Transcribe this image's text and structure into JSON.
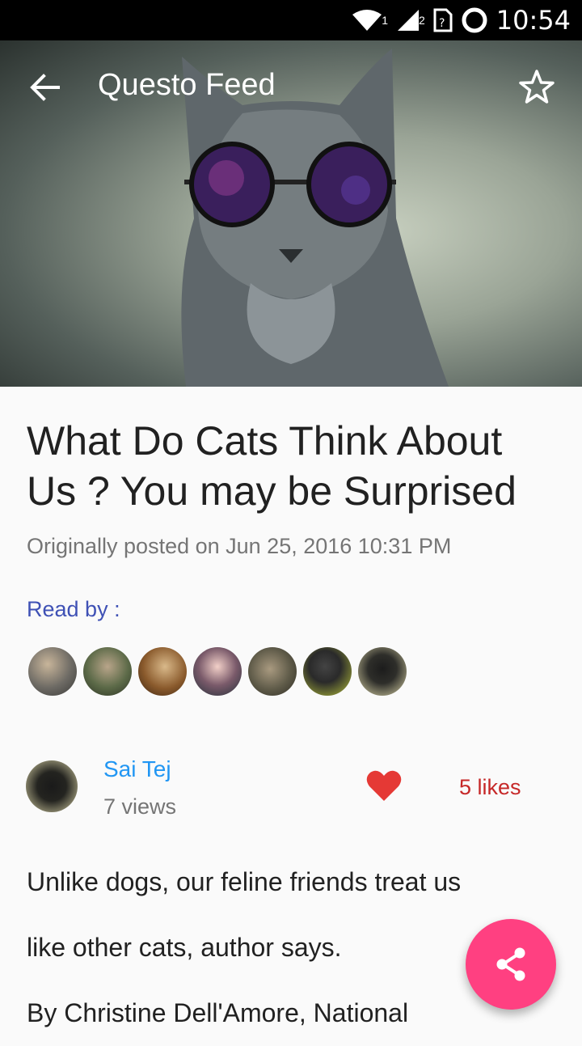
{
  "status_bar": {
    "time": "10:54",
    "sim1": "1",
    "sim2": "2"
  },
  "toolbar": {
    "title": "Questo Feed",
    "back_icon": "arrow-left-icon",
    "star_icon": "star-outline-icon"
  },
  "article": {
    "title": "What Do Cats Think About Us ? You may be Surprised",
    "posted": "Originally posted on Jun 25, 2016 10:31 PM"
  },
  "read_by": {
    "label": "Read by :",
    "count": 7
  },
  "author": {
    "name": "Sai Tej",
    "views": "7 views",
    "likes": "5 likes"
  },
  "body": {
    "lines": [
      "Unlike dogs, our feline friends treat us",
      "like other cats, author says.",
      "By Christine Dell'Amore, National"
    ]
  },
  "colors": {
    "accent": "#ff4081",
    "link": "#2196f3",
    "label_blue": "#3f51b5",
    "heart": "#e53935",
    "likes": "#c62828"
  }
}
